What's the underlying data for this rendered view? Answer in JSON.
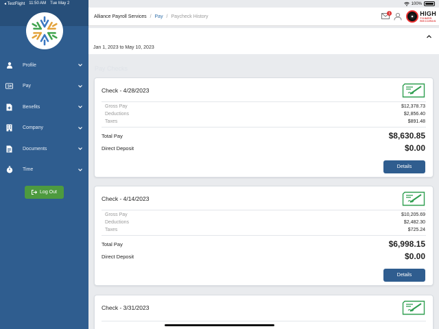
{
  "status_bar": {
    "carrier": "◂ TestFlight",
    "time": "11:50 AM",
    "date": "Tue May 2",
    "battery": "100%"
  },
  "sidebar": {
    "items": [
      {
        "label": "Profile",
        "icon": "person-icon"
      },
      {
        "label": "Pay",
        "icon": "money-icon"
      },
      {
        "label": "Benefits",
        "icon": "medical-icon"
      },
      {
        "label": "Company",
        "icon": "building-icon"
      },
      {
        "label": "Documents",
        "icon": "document-icon"
      },
      {
        "label": "Time",
        "icon": "stopwatch-icon"
      }
    ],
    "logout_label": "Log Out"
  },
  "header": {
    "breadcrumb": {
      "root": "Alliance Payroll Services",
      "pay": "Pay",
      "current": "Paycheck History"
    },
    "notification_count": "1",
    "brand": {
      "line1": "HIGH",
      "line2": "TOWER",
      "line3": "RECORDS"
    }
  },
  "filter": {
    "date_range": "Jan 1, 2023 to May 10, 2023"
  },
  "section_title": "Pay Checks",
  "checks": [
    {
      "title": "Check - 4/28/2023",
      "gross_label": "Gross Pay",
      "gross": "$12,378.73",
      "deductions_label": "Deductions",
      "deductions": "$2,856.40",
      "taxes_label": "Taxes",
      "taxes": "$891.48",
      "total_label": "Total Pay",
      "total": "$8,630.85",
      "deposit_label": "Direct Deposit",
      "deposit": "$0.00",
      "details_label": "Details"
    },
    {
      "title": "Check - 4/14/2023",
      "gross_label": "Gross Pay",
      "gross": "$10,205.69",
      "deductions_label": "Deductions",
      "deductions": "$2,482.30",
      "taxes_label": "Taxes",
      "taxes": "$725.24",
      "total_label": "Total Pay",
      "total": "$6,998.15",
      "deposit_label": "Direct Deposit",
      "deposit": "$0.00",
      "details_label": "Details"
    },
    {
      "title": "Check - 3/31/2023"
    }
  ],
  "colors": {
    "sidebar": "#2f5d8f",
    "accent_green": "#2e9e4f",
    "logout": "#4d9a3f"
  }
}
